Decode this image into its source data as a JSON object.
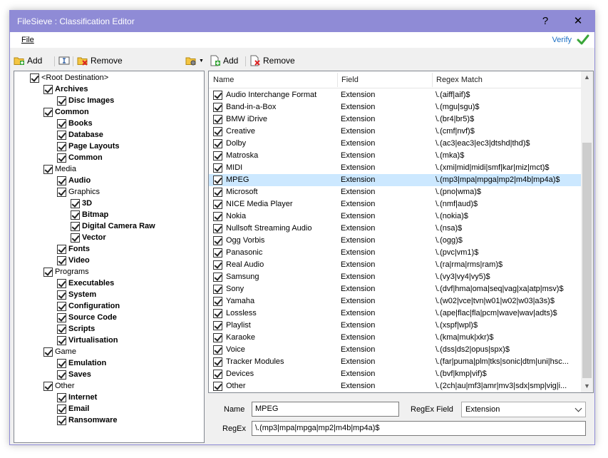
{
  "window": {
    "title": "FileSieve : Classification Editor",
    "help": "?",
    "close": "✕"
  },
  "menu": {
    "file": "File",
    "verify": "Verify"
  },
  "tree_toolbar": {
    "add": "Add",
    "remove": "Remove"
  },
  "grid_toolbar": {
    "add": "Add",
    "remove": "Remove"
  },
  "tree": [
    {
      "label": "<Root Destination>",
      "level": 0,
      "bold": false,
      "checked": true
    },
    {
      "label": "Archives",
      "level": 1,
      "bold": true,
      "checked": true
    },
    {
      "label": "Disc Images",
      "level": 2,
      "bold": true,
      "checked": true
    },
    {
      "label": "Common",
      "level": 1,
      "bold": true,
      "checked": true
    },
    {
      "label": "Books",
      "level": 2,
      "bold": true,
      "checked": true
    },
    {
      "label": "Database",
      "level": 2,
      "bold": true,
      "checked": true
    },
    {
      "label": "Page Layouts",
      "level": 2,
      "bold": true,
      "checked": true
    },
    {
      "label": "Common",
      "level": 2,
      "bold": true,
      "checked": true
    },
    {
      "label": "Media",
      "level": 1,
      "bold": false,
      "checked": true
    },
    {
      "label": "Audio",
      "level": 2,
      "bold": true,
      "checked": true
    },
    {
      "label": "Graphics",
      "level": 2,
      "bold": false,
      "checked": true
    },
    {
      "label": "3D",
      "level": 3,
      "bold": true,
      "checked": true
    },
    {
      "label": "Bitmap",
      "level": 3,
      "bold": true,
      "checked": true
    },
    {
      "label": "Digital Camera Raw",
      "level": 3,
      "bold": true,
      "checked": true
    },
    {
      "label": "Vector",
      "level": 3,
      "bold": true,
      "checked": true
    },
    {
      "label": "Fonts",
      "level": 2,
      "bold": true,
      "checked": true
    },
    {
      "label": "Video",
      "level": 2,
      "bold": true,
      "checked": true
    },
    {
      "label": "Programs",
      "level": 1,
      "bold": false,
      "checked": true
    },
    {
      "label": "Executables",
      "level": 2,
      "bold": true,
      "checked": true
    },
    {
      "label": "System",
      "level": 2,
      "bold": true,
      "checked": true
    },
    {
      "label": "Configuration",
      "level": 2,
      "bold": true,
      "checked": true
    },
    {
      "label": "Source Code",
      "level": 2,
      "bold": true,
      "checked": true
    },
    {
      "label": "Scripts",
      "level": 2,
      "bold": true,
      "checked": true
    },
    {
      "label": "Virtualisation",
      "level": 2,
      "bold": true,
      "checked": true
    },
    {
      "label": "Game",
      "level": 1,
      "bold": false,
      "checked": true
    },
    {
      "label": "Emulation",
      "level": 2,
      "bold": true,
      "checked": true
    },
    {
      "label": "Saves",
      "level": 2,
      "bold": true,
      "checked": true
    },
    {
      "label": "Other",
      "level": 1,
      "bold": false,
      "checked": true
    },
    {
      "label": "Internet",
      "level": 2,
      "bold": true,
      "checked": true
    },
    {
      "label": "Email",
      "level": 2,
      "bold": true,
      "checked": true
    },
    {
      "label": "Ransomware",
      "level": 2,
      "bold": true,
      "checked": true
    }
  ],
  "grid": {
    "columns": [
      "Name",
      "Field",
      "Regex Match"
    ],
    "selected_index": 7,
    "rows": [
      {
        "name": "Audio Interchange Format",
        "field": "Extension",
        "regex": "\\.(aiff|aif)$"
      },
      {
        "name": "Band-in-a-Box",
        "field": "Extension",
        "regex": "\\.(mgu|sgu)$"
      },
      {
        "name": "BMW iDrive",
        "field": "Extension",
        "regex": "\\.(br4|br5)$"
      },
      {
        "name": "Creative",
        "field": "Extension",
        "regex": "\\.(cmf|nvf)$"
      },
      {
        "name": "Dolby",
        "field": "Extension",
        "regex": "\\.(ac3|eac3|ec3|dtshd|thd)$"
      },
      {
        "name": "Matroska",
        "field": "Extension",
        "regex": "\\.(mka)$"
      },
      {
        "name": "MIDI",
        "field": "Extension",
        "regex": "\\.(xmi|mid|midi|smf|kar|miz|mct)$"
      },
      {
        "name": "MPEG",
        "field": "Extension",
        "regex": "\\.(mp3|mpa|mpga|mp2|m4b|mp4a)$"
      },
      {
        "name": "Microsoft",
        "field": "Extension",
        "regex": "\\.(pno|wma)$"
      },
      {
        "name": "NICE Media Player",
        "field": "Extension",
        "regex": "\\.(nmf|aud)$"
      },
      {
        "name": "Nokia",
        "field": "Extension",
        "regex": "\\.(nokia)$"
      },
      {
        "name": "Nullsoft Streaming Audio",
        "field": "Extension",
        "regex": "\\.(nsa)$"
      },
      {
        "name": "Ogg Vorbis",
        "field": "Extension",
        "regex": "\\.(ogg)$"
      },
      {
        "name": "Panasonic",
        "field": "Extension",
        "regex": "\\.(pvc|vm1)$"
      },
      {
        "name": "Real Audio",
        "field": "Extension",
        "regex": "\\.(ra|rma|rms|ram)$"
      },
      {
        "name": "Samsung",
        "field": "Extension",
        "regex": "\\.(vy3|vy4|vy5)$"
      },
      {
        "name": "Sony",
        "field": "Extension",
        "regex": "\\.(dvf|hma|oma|seq|vag|xa|atp|msv)$"
      },
      {
        "name": "Yamaha",
        "field": "Extension",
        "regex": "\\.(w02|vce|tvn|w01|w02|w03|a3s)$"
      },
      {
        "name": "Lossless",
        "field": "Extension",
        "regex": "\\.(ape|flac|fla|pcm|wave|wav|adts)$"
      },
      {
        "name": "Playlist",
        "field": "Extension",
        "regex": "\\.(xspf|wpl)$"
      },
      {
        "name": "Karaoke",
        "field": "Extension",
        "regex": "\\.(kma|muk|xkr)$"
      },
      {
        "name": "Voice",
        "field": "Extension",
        "regex": "\\.(dss|ds2|opus|spx)$"
      },
      {
        "name": "Tracker Modules",
        "field": "Extension",
        "regex": "\\.(far|puma|plm|tks|sonic|dtm|uni|hsc..."
      },
      {
        "name": "Devices",
        "field": "Extension",
        "regex": "\\.(bvf|kmp|vif)$"
      },
      {
        "name": "Other",
        "field": "Extension",
        "regex": "\\.(2ch|au|mf3|amr|mv3|sdx|smp|vig|i..."
      }
    ]
  },
  "details": {
    "name_label": "Name",
    "name_value": "MPEG",
    "regex_field_label": "RegEx Field",
    "regex_field_value": "Extension",
    "regex_label": "RegEx",
    "regex_value": "\\.(mp3|mpa|mpga|mp2|m4b|mp4a)$"
  },
  "colors": {
    "titlebar": "#8f8bd6",
    "selection": "#cce8ff",
    "verify_link": "#1a6fc4",
    "verify_check": "#3aa63a"
  }
}
